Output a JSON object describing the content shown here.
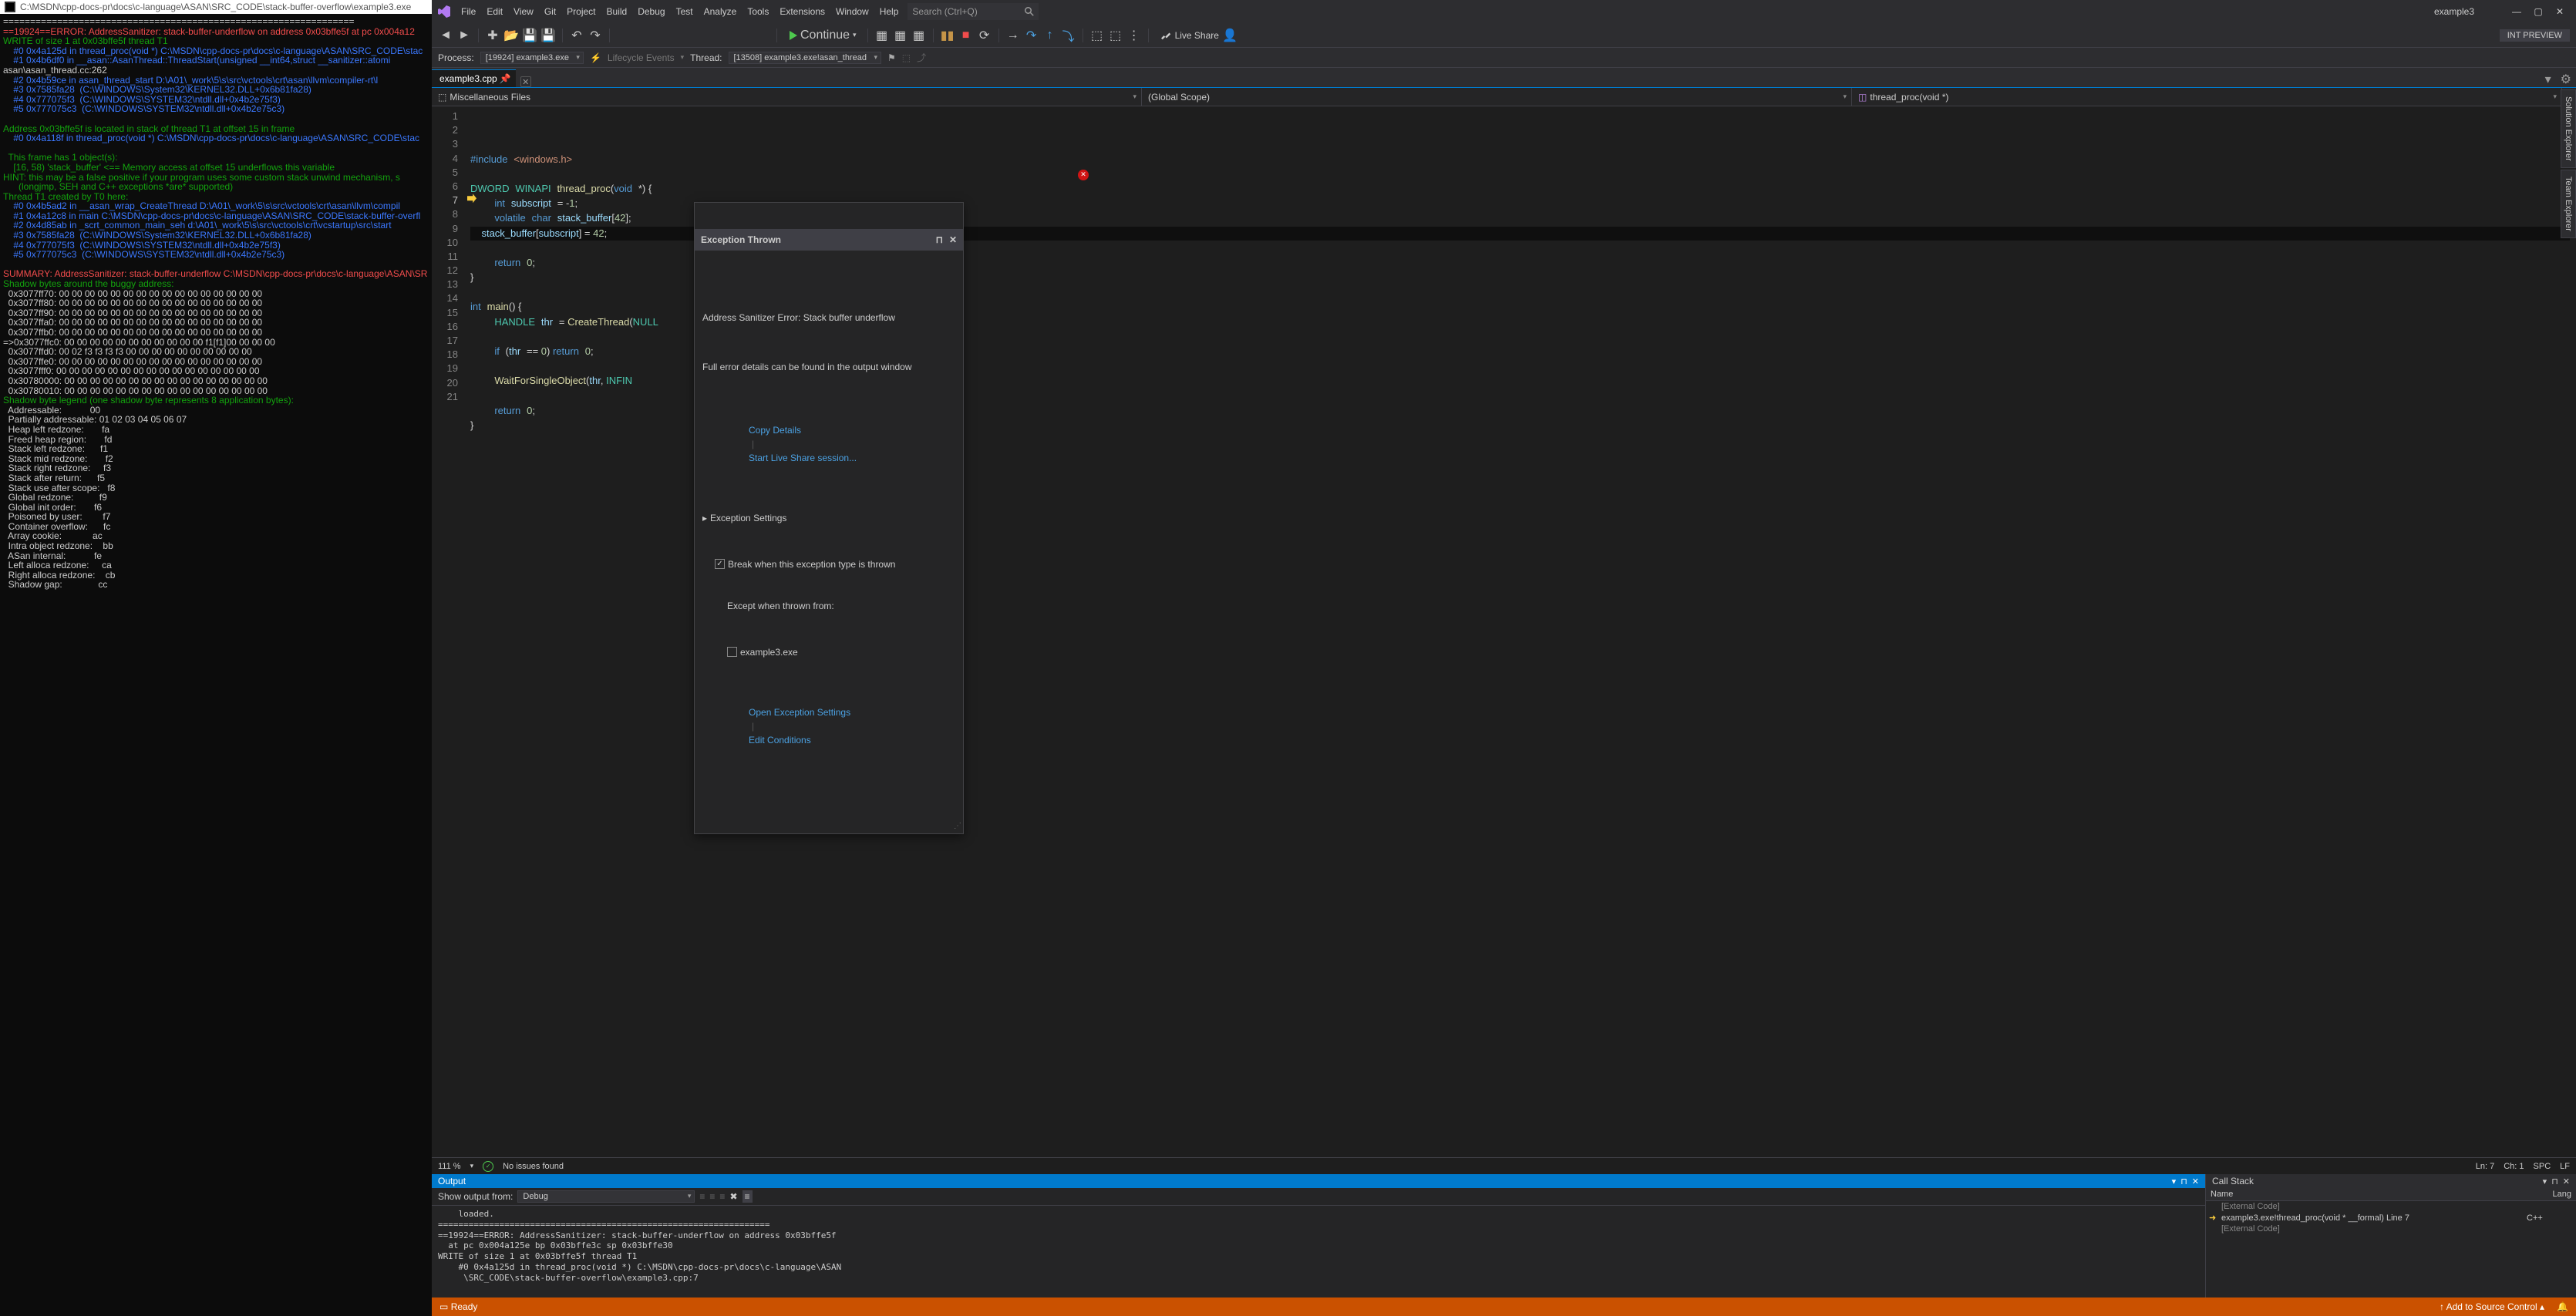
{
  "console": {
    "path": "C:\\MSDN\\cpp-docs-pr\\docs\\c-language\\ASAN\\SRC_CODE\\stack-buffer-overflow\\example3.exe",
    "lines": [
      "=================================================================",
      "==19924==ERROR: AddressSanitizer: stack-buffer-underflow on address 0x03bffe5f at pc 0x004a12",
      "WRITE of size 1 at 0x03bffe5f thread T1",
      "    #0 0x4a125d in thread_proc(void *) C:\\MSDN\\cpp-docs-pr\\docs\\c-language\\ASAN\\SRC_CODE\\stac",
      "    #1 0x4b6df0 in __asan::AsanThread::ThreadStart(unsigned __int64,struct __sanitizer::atomi",
      "asan\\asan_thread.cc:262",
      "    #2 0x4b59ce in asan_thread_start D:\\A01\\_work\\5\\s\\src\\vctools\\crt\\asan\\llvm\\compiler-rt\\l",
      "    #3 0x7585fa28  (C:\\WINDOWS\\System32\\KERNEL32.DLL+0x6b81fa28)",
      "    #4 0x777075f3  (C:\\WINDOWS\\SYSTEM32\\ntdll.dll+0x4b2e75f3)",
      "    #5 0x777075c3  (C:\\WINDOWS\\SYSTEM32\\ntdll.dll+0x4b2e75c3)",
      "",
      "Address 0x03bffe5f is located in stack of thread T1 at offset 15 in frame",
      "    #0 0x4a118f in thread_proc(void *) C:\\MSDN\\cpp-docs-pr\\docs\\c-language\\ASAN\\SRC_CODE\\stac",
      "",
      "  This frame has 1 object(s):",
      "    [16, 58) 'stack_buffer' <== Memory access at offset 15 underflows this variable",
      "HINT: this may be a false positive if your program uses some custom stack unwind mechanism, s",
      "      (longjmp, SEH and C++ exceptions *are* supported)",
      "Thread T1 created by T0 here:",
      "    #0 0x4b5ad2 in __asan_wrap_CreateThread D:\\A01\\_work\\5\\s\\src\\vctools\\crt\\asan\\llvm\\compil",
      "    #1 0x4a12c8 in main C:\\MSDN\\cpp-docs-pr\\docs\\c-language\\ASAN\\SRC_CODE\\stack-buffer-overfl",
      "    #2 0x4d85ab in _scrt_common_main_seh d:\\A01\\_work\\5\\s\\src\\vctools\\crt\\vcstartup\\src\\start",
      "    #3 0x7585fa28  (C:\\WINDOWS\\System32\\KERNEL32.DLL+0x6b81fa28)",
      "    #4 0x777075f3  (C:\\WINDOWS\\SYSTEM32\\ntdll.dll+0x4b2e75f3)",
      "    #5 0x777075c3  (C:\\WINDOWS\\SYSTEM32\\ntdll.dll+0x4b2e75c3)",
      "",
      "SUMMARY: AddressSanitizer: stack-buffer-underflow C:\\MSDN\\cpp-docs-pr\\docs\\c-language\\ASAN\\SR",
      "Shadow bytes around the buggy address:",
      "  0x3077ff70: 00 00 00 00 00 00 00 00 00 00 00 00 00 00 00 00",
      "  0x3077ff80: 00 00 00 00 00 00 00 00 00 00 00 00 00 00 00 00",
      "  0x3077ff90: 00 00 00 00 00 00 00 00 00 00 00 00 00 00 00 00",
      "  0x3077ffa0: 00 00 00 00 00 00 00 00 00 00 00 00 00 00 00 00",
      "  0x3077ffb0: 00 00 00 00 00 00 00 00 00 00 00 00 00 00 00 00",
      "=>0x3077ffc0: 00 00 00 00 00 00 00 00 00 00 00 f1[f1]00 00 00 00",
      "  0x3077ffd0: 00 02 f3 f3 f3 f3 00 00 00 00 00 00 00 00 00 00",
      "  0x3077ffe0: 00 00 00 00 00 00 00 00 00 00 00 00 00 00 00 00",
      "  0x3077fff0: 00 00 00 00 00 00 00 00 00 00 00 00 00 00 00 00",
      "  0x30780000: 00 00 00 00 00 00 00 00 00 00 00 00 00 00 00 00",
      "  0x30780010: 00 00 00 00 00 00 00 00 00 00 00 00 00 00 00 00",
      "Shadow byte legend (one shadow byte represents 8 application bytes):",
      "  Addressable:           00",
      "  Partially addressable: 01 02 03 04 05 06 07",
      "  Heap left redzone:       fa",
      "  Freed heap region:       fd",
      "  Stack left redzone:      f1",
      "  Stack mid redzone:       f2",
      "  Stack right redzone:     f3",
      "  Stack after return:      f5",
      "  Stack use after scope:   f8",
      "  Global redzone:          f9",
      "  Global init order:       f6",
      "  Poisoned by user:        f7",
      "  Container overflow:      fc",
      "  Array cookie:            ac",
      "  Intra object redzone:    bb",
      "  ASan internal:           fe",
      "  Left alloca redzone:     ca",
      "  Right alloca redzone:    cb",
      "  Shadow gap:              cc"
    ]
  },
  "menu": [
    "File",
    "Edit",
    "View",
    "Git",
    "Project",
    "Build",
    "Debug",
    "Test",
    "Analyze",
    "Tools",
    "Extensions",
    "Window",
    "Help"
  ],
  "search_placeholder": "Search (Ctrl+Q)",
  "solution_name": "example3",
  "toolbar": {
    "continue": "Continue",
    "live_share": "Live Share",
    "int_preview": "INT PREVIEW"
  },
  "debugbar": {
    "process_lbl": "Process:",
    "process": "[19924] example3.exe",
    "lifecycle": "Lifecycle Events",
    "thread_lbl": "Thread:",
    "thread": "[13508] example3.exe!asan_thread"
  },
  "tab": {
    "name": "example3.cpp"
  },
  "navbar": {
    "file": "Miscellaneous Files",
    "scope": "(Global Scope)",
    "member": "thread_proc(void *)"
  },
  "lines": [
    "1",
    "2",
    "3",
    "4",
    "5",
    "6",
    "7",
    "8",
    "9",
    "10",
    "11",
    "12",
    "13",
    "14",
    "15",
    "16",
    "17",
    "18",
    "19",
    "20",
    "21"
  ],
  "popup": {
    "title": "Exception Thrown",
    "msg1": "Address Sanitizer Error: Stack buffer underflow",
    "msg2": "Full error details can be found in the output window",
    "copy": "Copy Details",
    "live": "Start Live Share session...",
    "section": "Exception Settings",
    "opt1": "Break when this exception type is thrown",
    "except": "Except when thrown from:",
    "exe": "example3.exe",
    "open": "Open Exception Settings",
    "edit": "Edit Conditions"
  },
  "editor_status": {
    "zoom": "111 %",
    "issues": "No issues found",
    "ln": "Ln: 7",
    "ch": "Ch: 1",
    "spc": "SPC",
    "lf": "LF"
  },
  "output": {
    "title": "Output",
    "from": "Show output from:",
    "source": "Debug",
    "text": "    loaded.\n=================================================================\n==19924==ERROR: AddressSanitizer: stack-buffer-underflow on address 0x03bffe5f\n  at pc 0x004a125e bp 0x03bffe3c sp 0x03bffe30\nWRITE of size 1 at 0x03bffe5f thread T1\n    #0 0x4a125d in thread_proc(void *) C:\\MSDN\\cpp-docs-pr\\docs\\c-language\\ASAN\n     \\SRC_CODE\\stack-buffer-overflow\\example3.cpp:7"
  },
  "callstack": {
    "title": "Call Stack",
    "cols": [
      "Name",
      "Lang"
    ],
    "rows": [
      {
        "ext": true,
        "name": "[External Code]",
        "lang": ""
      },
      {
        "ext": false,
        "name": "example3.exe!thread_proc(void * __formal) Line 7",
        "lang": "C++"
      },
      {
        "ext": true,
        "name": "[External Code]",
        "lang": ""
      }
    ]
  },
  "status": {
    "ready": "Ready",
    "source": "Add to Source Control"
  },
  "sidetabs": [
    "Solution Explorer",
    "Team Explorer"
  ]
}
